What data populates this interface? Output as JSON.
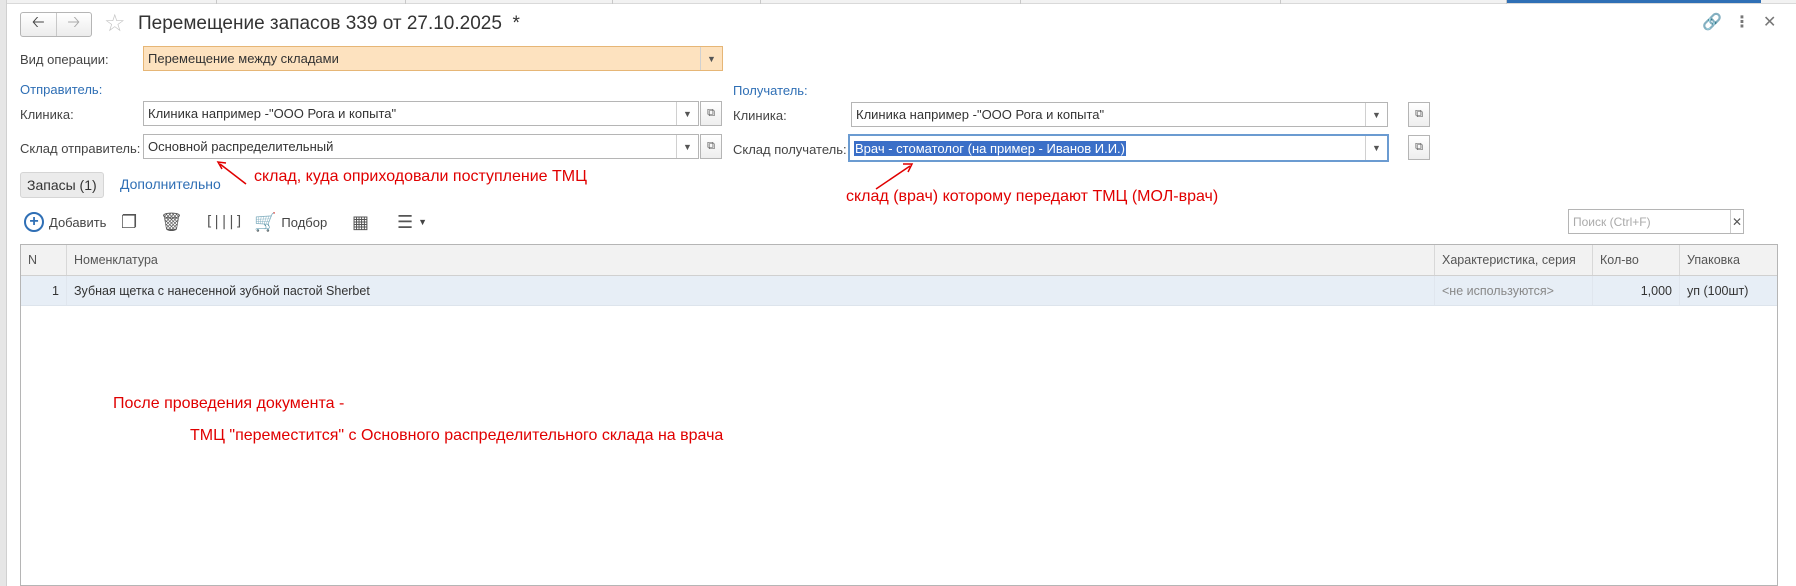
{
  "header": {
    "back_icon": "arrow-left-icon",
    "forward_icon": "arrow-right-icon",
    "favorite_icon": "star-icon",
    "title": "Перемещение запасов 339 от 27.10.2025",
    "modified_mark": "*",
    "link_icon": "link-icon",
    "more_icon": "more-vertical-icon",
    "close_icon": "close-icon"
  },
  "form": {
    "operation_label": "Вид операции:",
    "operation_value": "Перемещение между складами",
    "sender_section": "Отправитель:",
    "receiver_section": "Получатель:",
    "sender_clinic_label": "Клиника:",
    "sender_clinic_value": "Клиника например -\"ООО Рога и копыта\"",
    "receiver_clinic_label": "Клиника:",
    "receiver_clinic_value": "Клиника например -\"ООО Рога и копыта\"",
    "sender_warehouse_label": "Склад отправитель:",
    "sender_warehouse_value": "Основной распределительный",
    "receiver_warehouse_label": "Склад получатель:",
    "receiver_warehouse_value": "Врач - стоматолог (на пример - Иванов И.И.)"
  },
  "tabs": [
    {
      "label": "Запасы (1)",
      "active": true
    },
    {
      "label": "Дополнительно",
      "active": false
    }
  ],
  "toolbar": {
    "add_label": "Добавить",
    "pick_label": "Подбор",
    "search_placeholder": "Поиск (Ctrl+F)",
    "icons": [
      "add-icon",
      "copy-icon",
      "delete-icon",
      "barcode-icon",
      "cart-icon",
      "excel-icon",
      "menu-icon"
    ]
  },
  "table": {
    "columns": [
      "N",
      "Номенклатура",
      "Характеристика, серия",
      "Кол-во",
      "Упаковка"
    ],
    "rows": [
      [
        "1",
        "Зубная щетка с нанесенной зубной пастой Sherbet",
        "<не используются>",
        "1,000",
        "уп (100шт)"
      ]
    ]
  },
  "annotations": {
    "sender_note": "склад, куда оприходовали поступление ТМЦ",
    "receiver_note": "склад (врач) которому передают ТМЦ (МОЛ-врач)",
    "note_line1": "После проведения документа -",
    "note_line2": "ТМЦ \"переместится\" с Основного распределительного склада на врача",
    "color": "#e00000"
  },
  "colors": {
    "accent": "#2f6fb5",
    "operation_field_bg": "#fde2bf",
    "selected_row_bg": "#e7eef6",
    "selection": "#3b6fc7"
  }
}
